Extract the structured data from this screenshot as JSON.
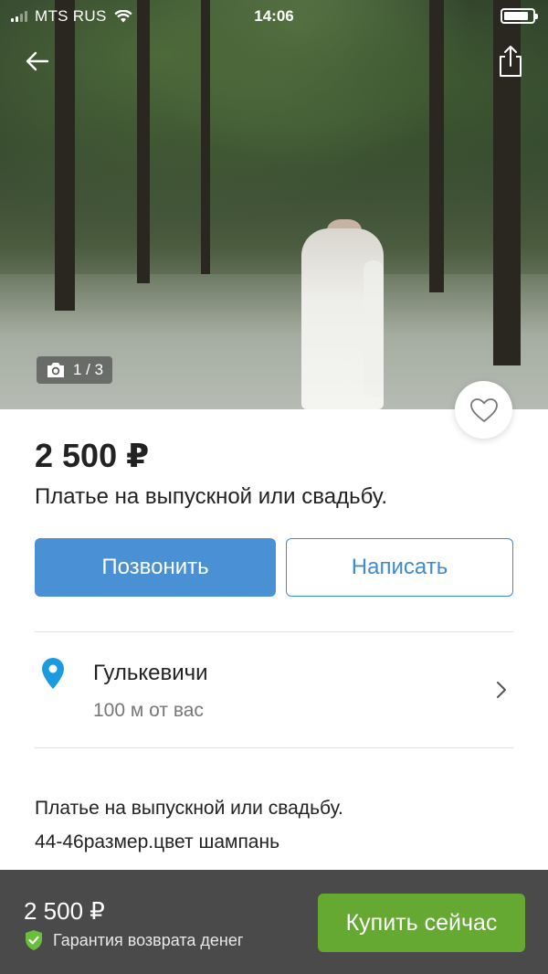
{
  "status_bar": {
    "carrier": "MTS RUS",
    "time": "14:06",
    "battery_level": 0.85
  },
  "gallery": {
    "counter": "1 / 3",
    "current": 1,
    "total": 3
  },
  "listing": {
    "price": "2 500 ₽",
    "title": "Платье на выпускной или свадьбу.",
    "description_lines": [
      "Платье на выпускной или свадьбу.",
      "44-46размер.цвет шампань"
    ]
  },
  "actions": {
    "call_label": "Позвонить",
    "write_label": "Написать"
  },
  "location": {
    "city": "Гулькевичи",
    "distance": "100  м от вас"
  },
  "bottom_bar": {
    "price": "2 500 ₽",
    "guarantee": "Гарантия возврата денег",
    "buy_label": "Купить сейчас"
  },
  "colors": {
    "accent_blue": "#4a90d4",
    "buy_green": "#65a832",
    "pin_blue": "#1a9be0",
    "guarantee_green": "#6abf3a",
    "bottom_bar_bg": "#4a4a4a"
  },
  "icons": {
    "back": "arrow-left-icon",
    "share": "share-icon",
    "camera": "camera-icon",
    "favorite": "heart-icon",
    "location": "map-pin-icon",
    "chevron": "chevron-right-icon",
    "guarantee": "shield-check-icon"
  }
}
